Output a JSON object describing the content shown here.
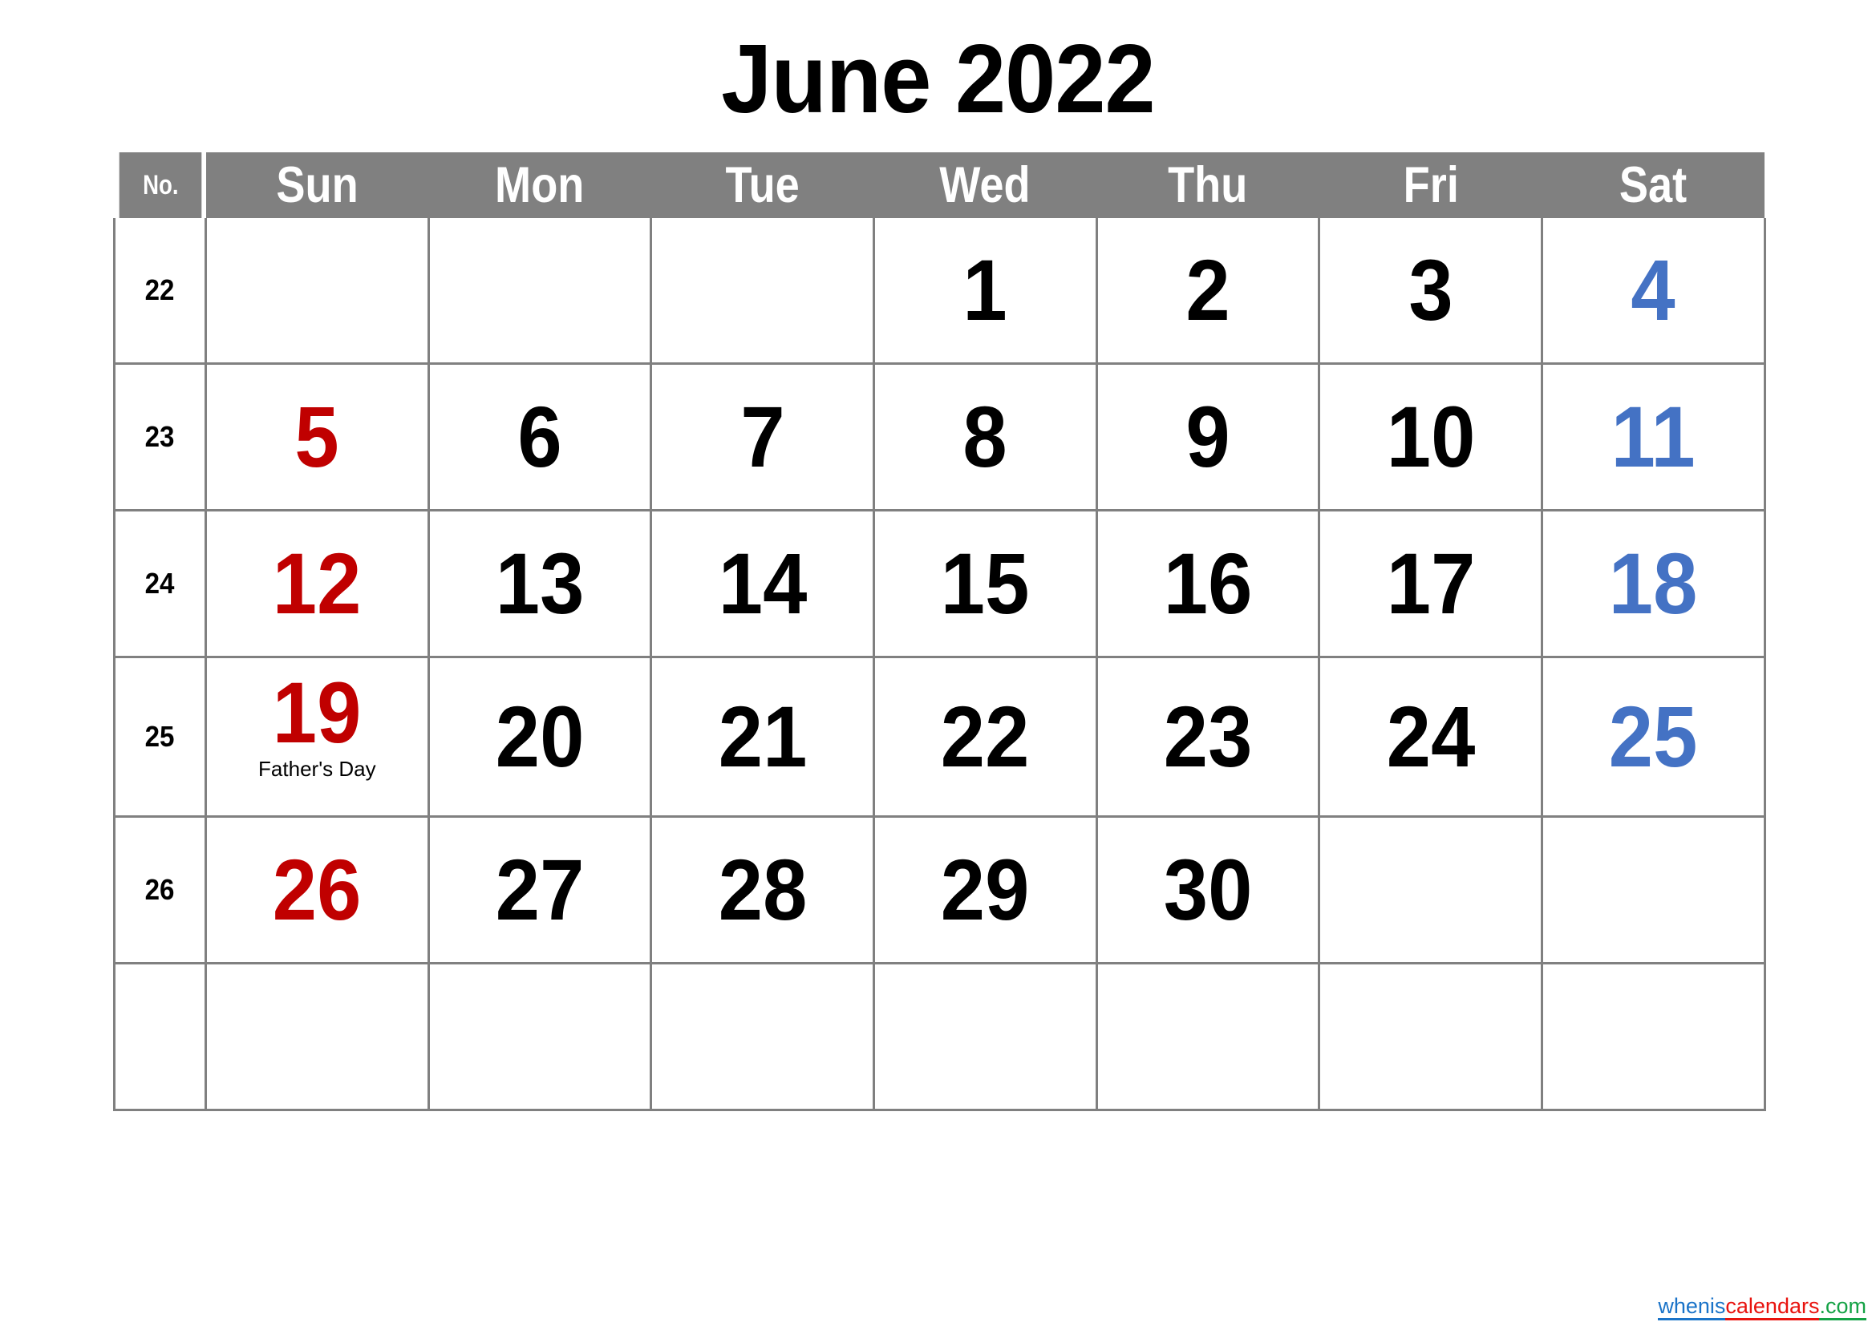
{
  "title": "June 2022",
  "header": {
    "week_label": "No.",
    "days": [
      "Sun",
      "Mon",
      "Tue",
      "Wed",
      "Thu",
      "Fri",
      "Sat"
    ]
  },
  "colors": {
    "header_background": "#808080",
    "header_text": "#ffffff",
    "grid_border": "#808080",
    "weekend_cell_background": "#f0f0f0",
    "sunday_text": "#c00000",
    "saturday_text": "#4472c4",
    "weekday_text": "#000000"
  },
  "weeks": [
    {
      "number": "22",
      "days": [
        {
          "date": "",
          "note": ""
        },
        {
          "date": "",
          "note": ""
        },
        {
          "date": "",
          "note": ""
        },
        {
          "date": "1",
          "note": ""
        },
        {
          "date": "2",
          "note": ""
        },
        {
          "date": "3",
          "note": ""
        },
        {
          "date": "4",
          "note": ""
        }
      ]
    },
    {
      "number": "23",
      "days": [
        {
          "date": "5",
          "note": ""
        },
        {
          "date": "6",
          "note": ""
        },
        {
          "date": "7",
          "note": ""
        },
        {
          "date": "8",
          "note": ""
        },
        {
          "date": "9",
          "note": ""
        },
        {
          "date": "10",
          "note": ""
        },
        {
          "date": "11",
          "note": ""
        }
      ]
    },
    {
      "number": "24",
      "days": [
        {
          "date": "12",
          "note": ""
        },
        {
          "date": "13",
          "note": ""
        },
        {
          "date": "14",
          "note": ""
        },
        {
          "date": "15",
          "note": ""
        },
        {
          "date": "16",
          "note": ""
        },
        {
          "date": "17",
          "note": ""
        },
        {
          "date": "18",
          "note": ""
        }
      ]
    },
    {
      "number": "25",
      "days": [
        {
          "date": "19",
          "note": "Father's Day"
        },
        {
          "date": "20",
          "note": ""
        },
        {
          "date": "21",
          "note": ""
        },
        {
          "date": "22",
          "note": ""
        },
        {
          "date": "23",
          "note": ""
        },
        {
          "date": "24",
          "note": ""
        },
        {
          "date": "25",
          "note": ""
        }
      ]
    },
    {
      "number": "26",
      "days": [
        {
          "date": "26",
          "note": ""
        },
        {
          "date": "27",
          "note": ""
        },
        {
          "date": "28",
          "note": ""
        },
        {
          "date": "29",
          "note": ""
        },
        {
          "date": "30",
          "note": ""
        },
        {
          "date": "",
          "note": ""
        },
        {
          "date": "",
          "note": ""
        }
      ]
    },
    {
      "number": "",
      "days": [
        {
          "date": "",
          "note": ""
        },
        {
          "date": "",
          "note": ""
        },
        {
          "date": "",
          "note": ""
        },
        {
          "date": "",
          "note": ""
        },
        {
          "date": "",
          "note": ""
        },
        {
          "date": "",
          "note": ""
        },
        {
          "date": "",
          "note": ""
        }
      ]
    }
  ],
  "watermark": {
    "part1": "whenis",
    "part2": "calendars",
    "part3": ".com"
  }
}
